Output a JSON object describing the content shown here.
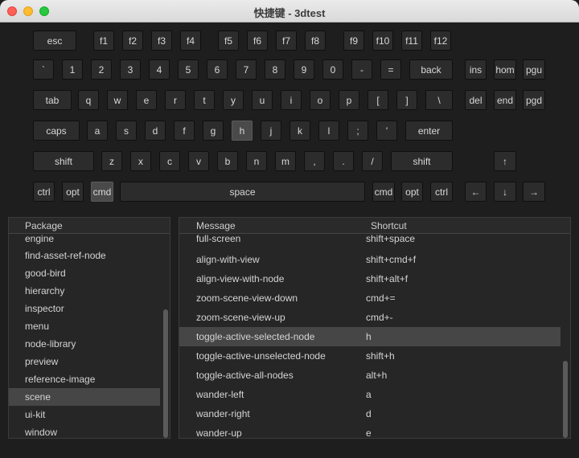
{
  "window": {
    "title": "快捷键 - 3dtest"
  },
  "keyboard": {
    "row1": [
      "esc",
      "f1",
      "f2",
      "f3",
      "f4",
      "f5",
      "f6",
      "f7",
      "f8",
      "f9",
      "f10",
      "f11",
      "f12"
    ],
    "row2": [
      "`",
      "1",
      "2",
      "3",
      "4",
      "5",
      "6",
      "7",
      "8",
      "9",
      "0",
      "-",
      "=",
      "back",
      "ins",
      "hom",
      "pgu"
    ],
    "row3": [
      "tab",
      "q",
      "w",
      "e",
      "r",
      "t",
      "y",
      "u",
      "i",
      "o",
      "p",
      "[",
      "]",
      "\\",
      "del",
      "end",
      "pgd"
    ],
    "row4": [
      "caps",
      "a",
      "s",
      "d",
      "f",
      "g",
      "h",
      "j",
      "k",
      "l",
      ";",
      "'",
      "enter"
    ],
    "row5": [
      "shift",
      "z",
      "x",
      "c",
      "v",
      "b",
      "n",
      "m",
      ",",
      ".",
      "/",
      "shift",
      "↑"
    ],
    "row6": [
      "ctrl",
      "opt",
      "cmd",
      "space",
      "cmd",
      "opt",
      "ctrl",
      "←",
      "↓",
      "→"
    ],
    "active_keys": [
      "h",
      "cmd"
    ]
  },
  "packages": {
    "header": "Package",
    "items": [
      "engine",
      "find-asset-ref-node",
      "good-bird",
      "hierarchy",
      "inspector",
      "menu",
      "node-library",
      "preview",
      "reference-image",
      "scene",
      "ui-kit",
      "window"
    ],
    "selected": "scene"
  },
  "shortcuts": {
    "header_message": "Message",
    "header_shortcut": "Shortcut",
    "rows": [
      {
        "message": "full-screen",
        "shortcut": "shift+space"
      },
      {
        "message": "align-with-view",
        "shortcut": "shift+cmd+f"
      },
      {
        "message": "align-view-with-node",
        "shortcut": "shift+alt+f"
      },
      {
        "message": "zoom-scene-view-down",
        "shortcut": "cmd+="
      },
      {
        "message": "zoom-scene-view-up",
        "shortcut": "cmd+-"
      },
      {
        "message": "toggle-active-selected-node",
        "shortcut": "h"
      },
      {
        "message": "toggle-active-unselected-node",
        "shortcut": "shift+h"
      },
      {
        "message": "toggle-active-all-nodes",
        "shortcut": "alt+h"
      },
      {
        "message": "wander-left",
        "shortcut": "a"
      },
      {
        "message": "wander-right",
        "shortcut": "d"
      },
      {
        "message": "wander-up",
        "shortcut": "e"
      }
    ],
    "selected_index": 5
  }
}
